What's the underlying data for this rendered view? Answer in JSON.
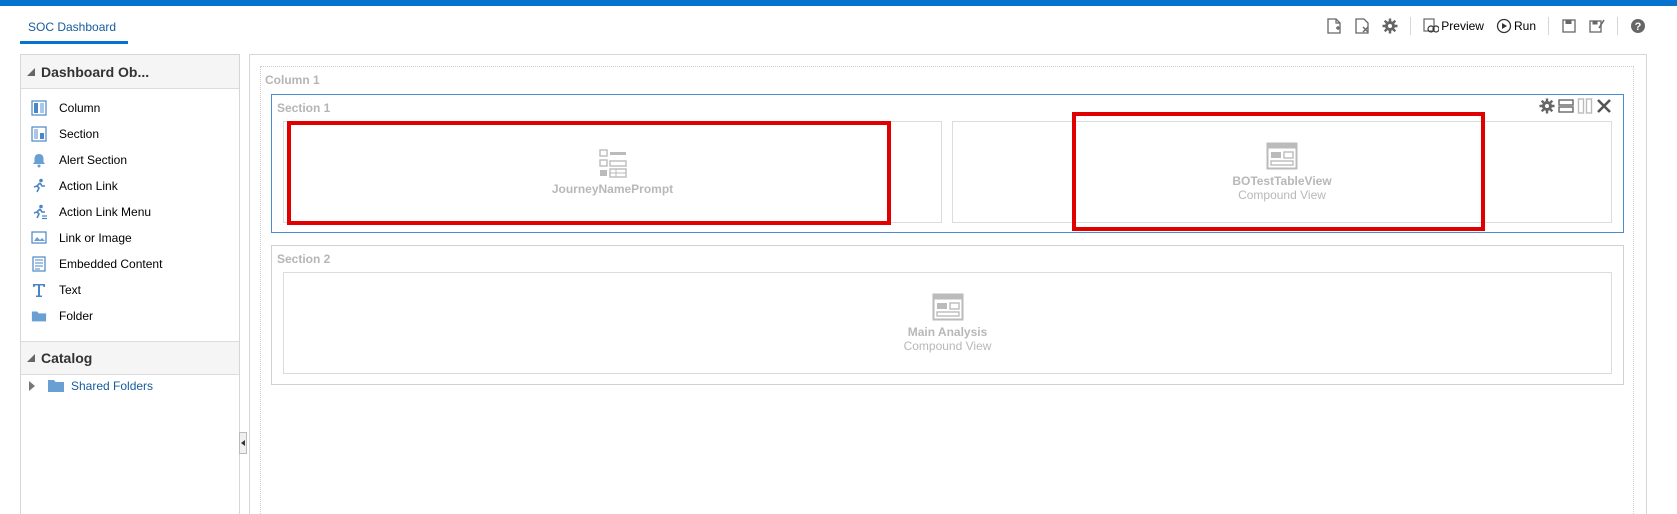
{
  "header": {
    "tab_label": "SOC Dashboard",
    "toolbar": {
      "preview_label": "Preview",
      "run_label": "Run"
    }
  },
  "left_panel": {
    "objects_title": "Dashboard Ob...",
    "items": [
      {
        "label": "Column",
        "icon": "column-icon"
      },
      {
        "label": "Section",
        "icon": "section-icon"
      },
      {
        "label": "Alert Section",
        "icon": "bell-icon"
      },
      {
        "label": "Action Link",
        "icon": "runner-icon"
      },
      {
        "label": "Action Link Menu",
        "icon": "runner-menu-icon"
      },
      {
        "label": "Link or Image",
        "icon": "image-link-icon"
      },
      {
        "label": "Embedded Content",
        "icon": "embedded-icon"
      },
      {
        "label": "Text",
        "icon": "text-icon"
      },
      {
        "label": "Folder",
        "icon": "folder-icon"
      }
    ],
    "catalog_title": "Catalog",
    "catalog_items": [
      {
        "label": "Shared Folders"
      }
    ]
  },
  "canvas": {
    "column_label": "Column 1",
    "section1": {
      "label": "Section 1",
      "objects": [
        {
          "name": "JourneyNamePrompt",
          "sub": ""
        },
        {
          "name": "BOTestTableView",
          "sub": "Compound View"
        }
      ]
    },
    "section2": {
      "label": "Section 2",
      "objects": [
        {
          "name": "Main Analysis",
          "sub": "Compound View"
        }
      ]
    }
  },
  "colors": {
    "accent": "#0572ce",
    "highlight": "#e00000",
    "muted_text": "#b5b5b5",
    "link": "#145c9e"
  }
}
